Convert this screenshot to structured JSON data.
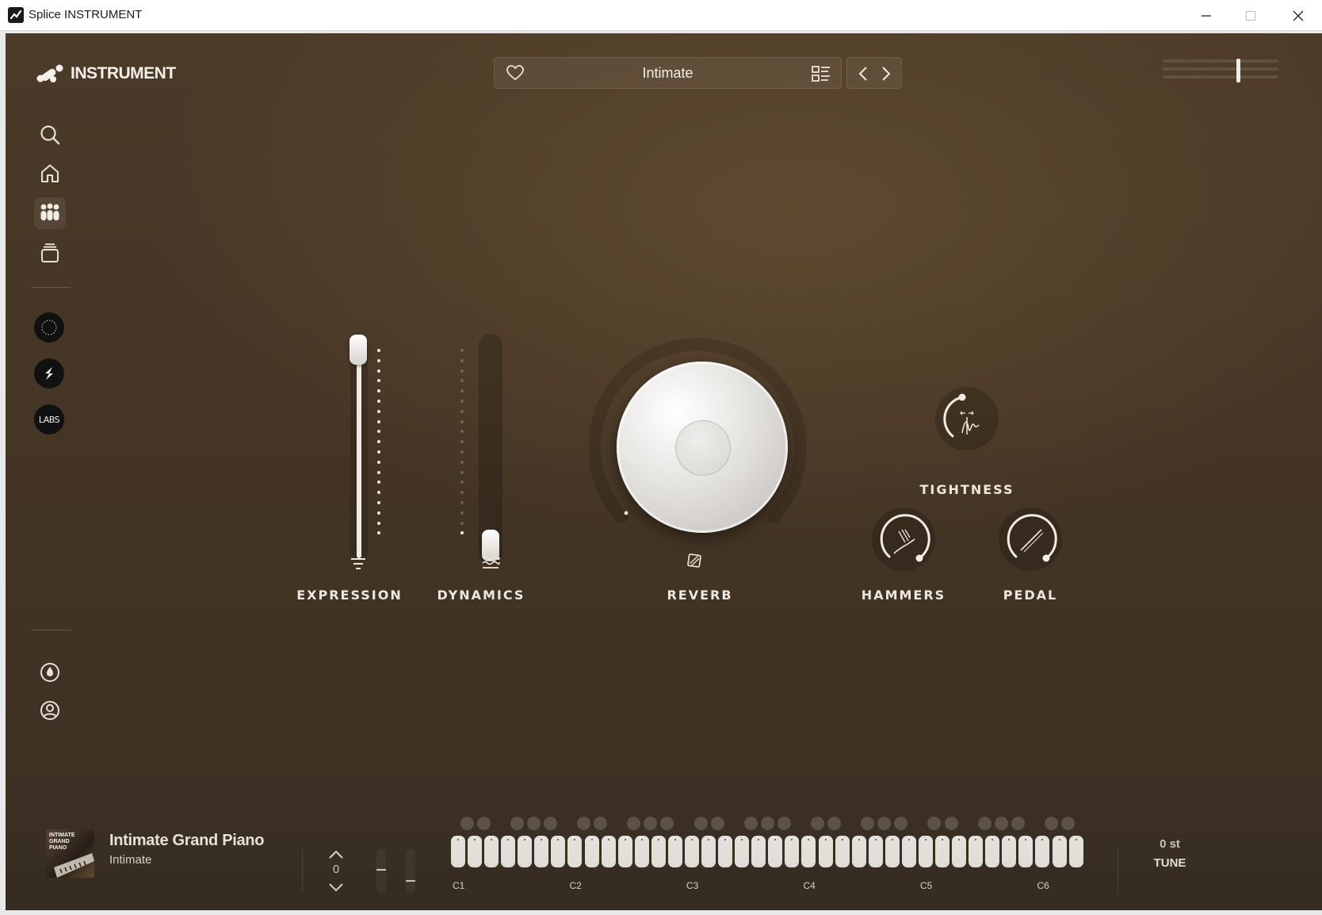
{
  "window": {
    "title": "Splice INSTRUMENT"
  },
  "header": {
    "logo_text": "INSTRUMENT",
    "preset_name": "Intimate",
    "volume_level": 0.66
  },
  "sidebar": {
    "items": [
      {
        "name": "search",
        "icon": "search-icon"
      },
      {
        "name": "home",
        "icon": "home-icon"
      },
      {
        "name": "instruments",
        "icon": "instruments-icon",
        "active": true
      },
      {
        "name": "library",
        "icon": "library-icon"
      }
    ],
    "sources": [
      {
        "name": "circle-logo",
        "icon": "circle-logo-icon"
      },
      {
        "name": "splice",
        "icon": "splice-logo-icon"
      },
      {
        "name": "labs",
        "label": "LABS"
      }
    ],
    "bottom": [
      {
        "name": "theme",
        "icon": "drop-icon"
      },
      {
        "name": "account",
        "icon": "user-icon"
      }
    ]
  },
  "controls": {
    "expression": {
      "label": "EXPRESSION",
      "value": 1.0
    },
    "dynamics": {
      "label": "DYNAMICS",
      "value": 0.0
    },
    "reverb": {
      "label": "REVERB"
    },
    "tightness": {
      "label": "TIGHTNESS"
    },
    "hammers": {
      "label": "HAMMERS"
    },
    "pedal": {
      "label": "PEDAL"
    }
  },
  "footer": {
    "cover_text": "INTIMATE GRAND PIANO",
    "instrument_name": "Intimate Grand Piano",
    "preset_name": "Intimate",
    "octave": "0",
    "octave_labels": [
      "C1",
      "C2",
      "C3",
      "C4",
      "C5",
      "C6"
    ],
    "tune_value": "0 st",
    "tune_label": "TUNE"
  },
  "colors": {
    "background": "#443525",
    "accent": "#f1ede6"
  }
}
